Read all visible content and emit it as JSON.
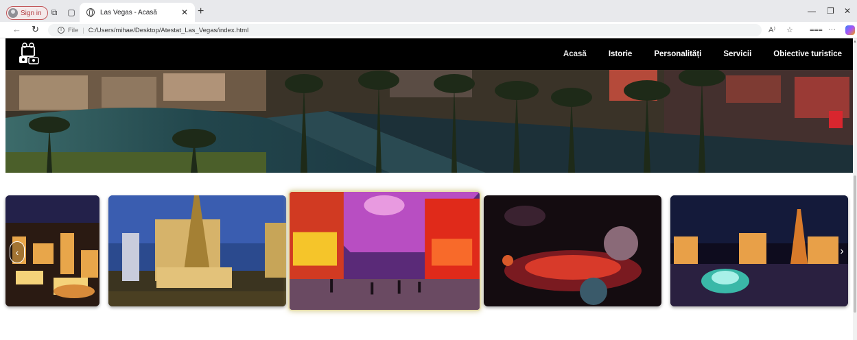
{
  "browser": {
    "signin_label": "Sign in",
    "tab_title": "Las Vegas - Acasă",
    "url_prefix": "File",
    "url": "C:/Users/mihae/Desktop/Atestat_Las_Vegas/index.html",
    "icons": [
      "back-icon",
      "reload-icon",
      "read-aloud-icon",
      "favorite-icon",
      "collections-icon",
      "more-icon",
      "copilot-icon"
    ]
  },
  "site": {
    "nav": {
      "items": [
        {
          "label": "Acasă",
          "active": true
        },
        {
          "label": "Istorie"
        },
        {
          "label": "Personalități"
        },
        {
          "label": "Servicii"
        },
        {
          "label": "Obiective turistice"
        }
      ]
    },
    "carousel": {
      "slides": [
        "vegas-strip-night",
        "paris-hotel",
        "fremont-street",
        "show-stage",
        "bellagio-fountains"
      ],
      "active_index": 2
    }
  }
}
